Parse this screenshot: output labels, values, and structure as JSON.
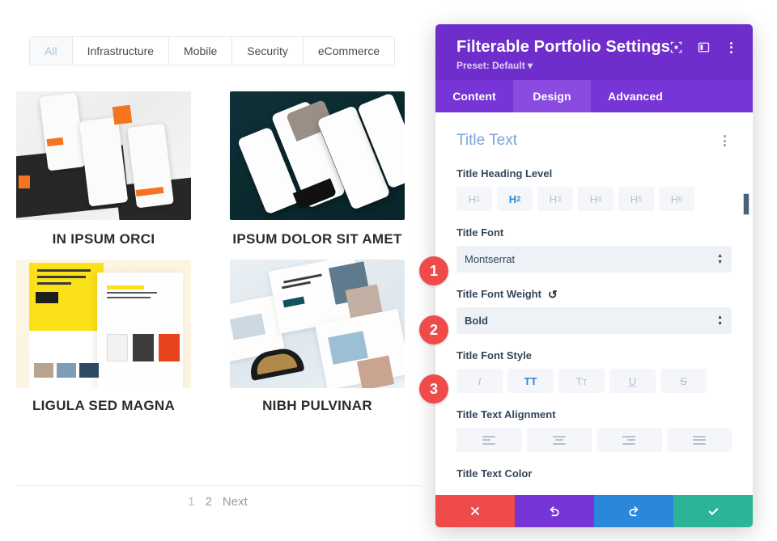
{
  "portfolio": {
    "filters": [
      {
        "label": "All",
        "active": true
      },
      {
        "label": "Infrastructure",
        "active": false
      },
      {
        "label": "Mobile",
        "active": false
      },
      {
        "label": "Security",
        "active": false
      },
      {
        "label": "eCommerce",
        "active": false
      }
    ],
    "items": [
      {
        "title": "IN IPSUM ORCI",
        "art": "mobile-app-orange-mockup"
      },
      {
        "title": "IPSUM DOLOR SIT AMET",
        "art": "ecommerce-phone-teal-mockup"
      },
      {
        "title": "LIGULA SED MAGNA",
        "art": "yellow-landing-page-mockup"
      },
      {
        "title": "NIBH PULVINAR",
        "art": "sunglasses-shop-web-mockup"
      }
    ],
    "pagination": [
      {
        "label": "1",
        "active": true
      },
      {
        "label": "2",
        "active": false
      },
      {
        "label": "Next",
        "active": false
      }
    ]
  },
  "settings": {
    "title": "Filterable Portfolio Settings",
    "preset": "Preset: Default ▾",
    "header_icons": [
      {
        "name": "expand-icon"
      },
      {
        "name": "layout-icon"
      },
      {
        "name": "more-options-icon"
      }
    ],
    "tabs": [
      {
        "label": "Content",
        "active": false
      },
      {
        "label": "Design",
        "active": true
      },
      {
        "label": "Advanced",
        "active": false
      }
    ],
    "section": {
      "title": "Title Text",
      "heading_level": {
        "label": "Title Heading Level",
        "options": [
          {
            "label": "H",
            "sub": "1",
            "active": false
          },
          {
            "label": "H",
            "sub": "2",
            "active": true
          },
          {
            "label": "H",
            "sub": "3",
            "active": false
          },
          {
            "label": "H",
            "sub": "4",
            "active": false
          },
          {
            "label": "H",
            "sub": "5",
            "active": false
          },
          {
            "label": "H",
            "sub": "6",
            "active": false
          }
        ]
      },
      "font": {
        "label": "Title Font",
        "value": "Montserrat"
      },
      "font_weight": {
        "label": "Title Font Weight",
        "value": "Bold",
        "reset": "↺"
      },
      "font_style": {
        "label": "Title Font Style",
        "options": [
          {
            "glyph": "I",
            "name": "italic",
            "active": false
          },
          {
            "glyph": "TT",
            "name": "uppercase",
            "active": true
          },
          {
            "glyph": "Tᴛ",
            "name": "small-caps",
            "active": false
          },
          {
            "glyph": "U",
            "name": "underline",
            "active": false
          },
          {
            "glyph": "S",
            "name": "strikethrough",
            "active": false
          }
        ]
      },
      "text_alignment": {
        "label": "Title Text Alignment",
        "options": [
          {
            "name": "align-left",
            "active": false
          },
          {
            "name": "align-center",
            "active": false
          },
          {
            "name": "align-right",
            "active": false
          },
          {
            "name": "align-justify",
            "active": false
          }
        ]
      },
      "text_color": {
        "label": "Title Text Color"
      }
    },
    "footer": [
      {
        "name": "cancel",
        "glyph": "✖",
        "color": "#ef4b4b"
      },
      {
        "name": "undo",
        "glyph": "↺",
        "color": "#7734d6"
      },
      {
        "name": "redo",
        "glyph": "↻",
        "color": "#2b87da"
      },
      {
        "name": "save",
        "glyph": "✔",
        "color": "#2bb596"
      }
    ]
  },
  "badges": [
    {
      "number": "1"
    },
    {
      "number": "2"
    },
    {
      "number": "3"
    }
  ],
  "colors": {
    "panel_header": "#6f2ecb",
    "tab_bar": "#7734d6",
    "tab_active": "#8b4be0",
    "accent_blue": "#2b87da",
    "section_title": "#7aa4d4",
    "badge_red": "#ef4b4b"
  }
}
